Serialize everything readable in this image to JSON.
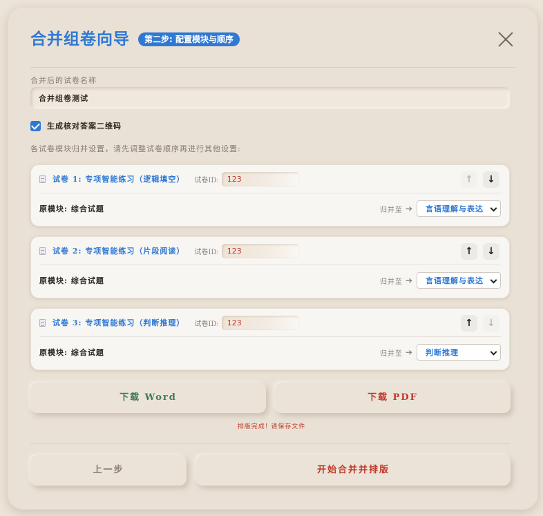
{
  "header": {
    "title": "合并组卷向导",
    "step_badge": "第二步: 配置模块与顺序"
  },
  "form": {
    "name_label": "合并后的试卷名称",
    "name_value": "合并组卷测试",
    "qr_checkbox_label": "生成核对答案二维码",
    "qr_checked": true,
    "instructions": "各试卷模块归并设置，请先调整试卷顺序再进行其他设置:"
  },
  "papers": [
    {
      "title": "试卷 1: 专项智能练习（逻辑填空）",
      "id_label": "试卷ID:",
      "id_value": "123",
      "original_module": "原模块: 综合试题",
      "merge_to_label": "归并至",
      "selected_module": "言语理解与表达",
      "up_enabled": false,
      "down_enabled": true
    },
    {
      "title": "试卷 2: 专项智能练习（片段阅读）",
      "id_label": "试卷ID:",
      "id_value": "123",
      "original_module": "原模块: 综合试题",
      "merge_to_label": "归并至",
      "selected_module": "言语理解与表达",
      "up_enabled": true,
      "down_enabled": true
    },
    {
      "title": "试卷 3: 专项智能练习（判断推理）",
      "id_label": "试卷ID:",
      "id_value": "123",
      "original_module": "原模块: 综合试题",
      "merge_to_label": "归并至",
      "selected_module": "判断推理",
      "up_enabled": true,
      "down_enabled": false
    }
  ],
  "actions": {
    "download_word": "下载 Word",
    "download_pdf": "下载 PDF",
    "status_message": "排版完成! 请保存文件",
    "prev_step": "上一步",
    "start_merge": "开始合并并排版"
  },
  "colors": {
    "accent": "#2f79d4",
    "word_green": "#3f7a55",
    "pdf_red": "#c0392b",
    "background": "#e9e1d5"
  }
}
